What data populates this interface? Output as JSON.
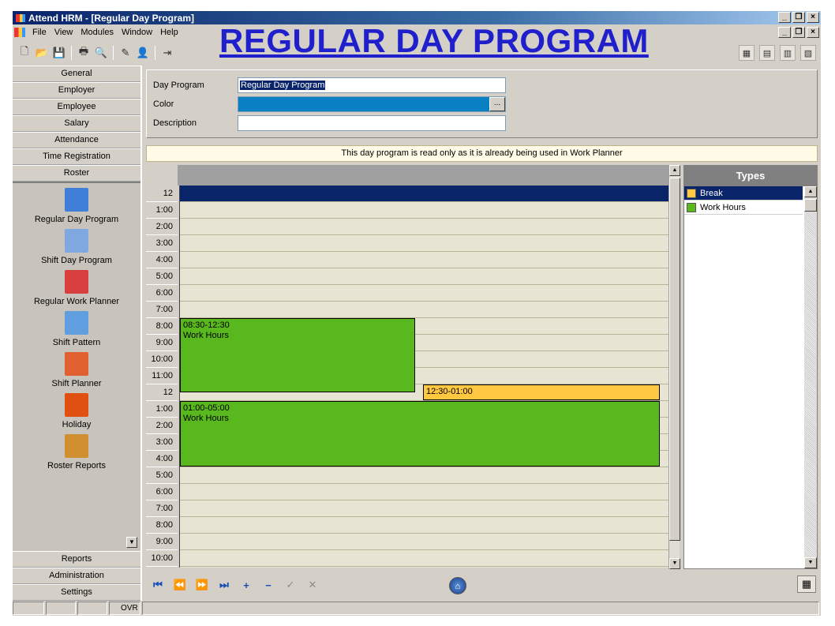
{
  "window": {
    "title": "Attend HRM - [Regular Day Program]",
    "min_label": "_",
    "max_label": "❐",
    "close_label": "×"
  },
  "menu": [
    "File",
    "View",
    "Modules",
    "Window",
    "Help"
  ],
  "heading": "REGULAR DAY PROGRAM",
  "toolbar_icons": [
    "new-icon",
    "open-icon",
    "save-icon",
    "print-icon",
    "preview-icon",
    "edit-icon",
    "user-icon",
    "exit-icon"
  ],
  "sidebar": {
    "top_nav": [
      "General",
      "Employer",
      "Employee",
      "Salary",
      "Attendance",
      "Time Registration",
      "Roster"
    ],
    "modules": [
      {
        "label": "Regular Day Program",
        "icon": "calendar-day-icon",
        "color": "#3f7fd8"
      },
      {
        "label": "Shift Day Program",
        "icon": "calendar-shift-icon",
        "color": "#7fa8e0"
      },
      {
        "label": "Regular Work Planner",
        "icon": "work-planner-icon",
        "color": "#d84040"
      },
      {
        "label": "Shift Pattern",
        "icon": "shift-pattern-icon",
        "color": "#5f9fe0"
      },
      {
        "label": "Shift Planner",
        "icon": "shift-planner-icon",
        "color": "#e06030"
      },
      {
        "label": "Holiday",
        "icon": "holiday-icon",
        "color": "#e05010"
      },
      {
        "label": "Roster Reports",
        "icon": "roster-reports-icon",
        "color": "#d09030"
      }
    ],
    "bottom_nav": [
      "Reports",
      "Administration",
      "Settings"
    ]
  },
  "status": {
    "cells": [
      "",
      "",
      "",
      "OVR"
    ]
  },
  "form": {
    "day_program_label": "Day Program",
    "day_program_value": "Regular Day Program",
    "color_label": "Color",
    "color_value": "#0a7fc4",
    "color_button": "...",
    "description_label": "Description",
    "description_value": ""
  },
  "notice": "This day program is read only as it is already being used in Work Planner",
  "schedule": {
    "times": [
      "12",
      "1:00",
      "2:00",
      "3:00",
      "4:00",
      "5:00",
      "6:00",
      "7:00",
      "8:00",
      "9:00",
      "10:00",
      "11:00",
      "12",
      "1:00",
      "2:00",
      "3:00",
      "4:00",
      "5:00",
      "6:00",
      "7:00",
      "8:00",
      "9:00",
      "10:00"
    ],
    "events": [
      {
        "time": "08:30-12:30",
        "type": "Work Hours",
        "start_slot": 8.0,
        "end_slot": 12.5,
        "start_col": 0.0,
        "end_col": 0.49
      },
      {
        "time": "12:30-01:00",
        "type": "",
        "start_slot": 12.0,
        "end_slot": 13.0,
        "start_col": 0.5,
        "end_col": 1.0
      },
      {
        "time": "01:00-05:00",
        "type": "Work Hours",
        "start_slot": 13.0,
        "end_slot": 17.0,
        "start_col": 0.0,
        "end_col": 1.0
      }
    ]
  },
  "types": {
    "header": "Types",
    "items": [
      {
        "label": "Break",
        "color": "#ffc840",
        "selected": true
      },
      {
        "label": "Work Hours",
        "color": "#58b81e",
        "selected": false
      }
    ]
  },
  "navigation": [
    "⏮",
    "⏪",
    "⏩",
    "⏭",
    "+",
    "−",
    "✓",
    "✕"
  ]
}
